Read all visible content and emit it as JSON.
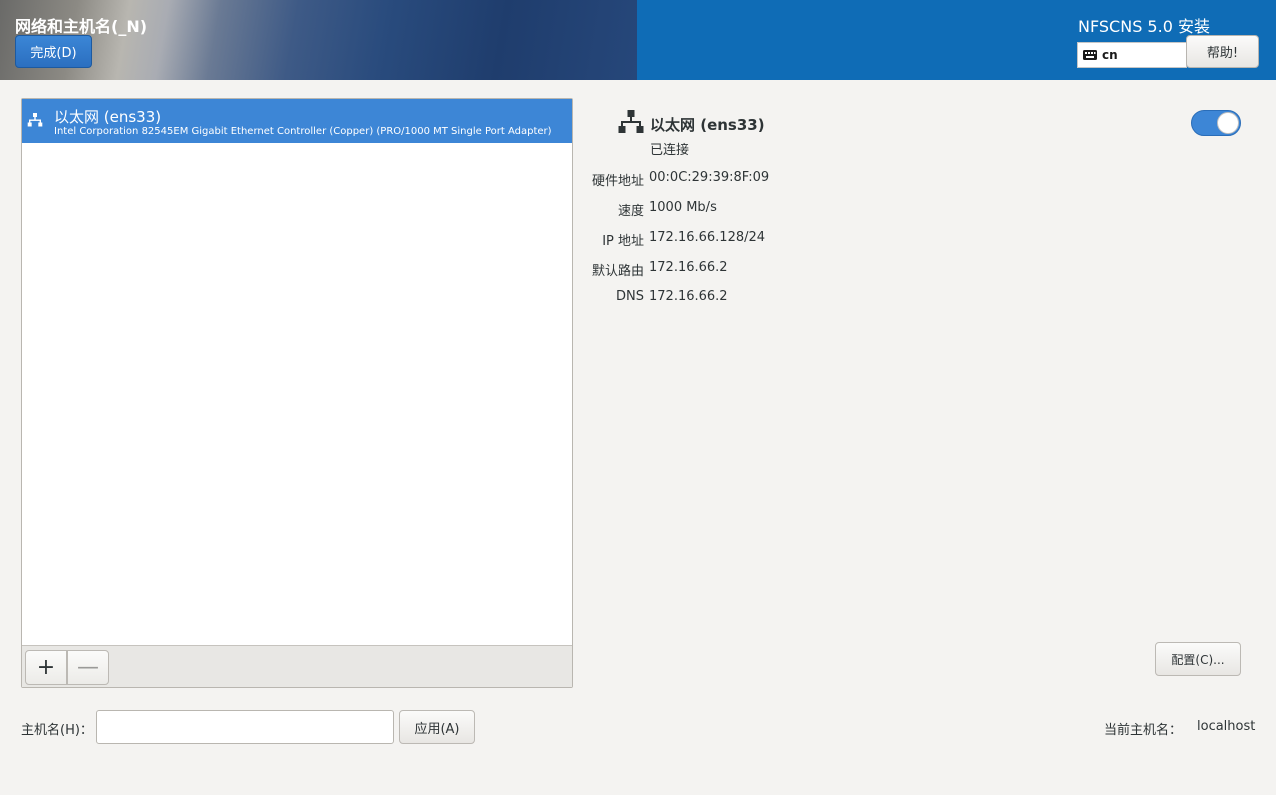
{
  "header": {
    "spoke_title": "网络和主机名(_N)",
    "done_label": "完成(D)",
    "product_title": "NFSCNS 5.0 安装",
    "keyboard_layout": "cn",
    "help_label": "帮助!"
  },
  "devices": [
    {
      "name": "以太网 (ens33)",
      "description": "Intel Corporation 82545EM Gigabit Ethernet Controller (Copper) (PRO/1000 MT Single Port Adapter)",
      "selected": true
    }
  ],
  "list_toolbar": {
    "add_label": "+",
    "remove_label": "—"
  },
  "detail": {
    "name": "以太网 (ens33)",
    "status": "已连接",
    "enabled": true,
    "properties": [
      {
        "label": "硬件地址",
        "value": "00:0C:29:39:8F:09"
      },
      {
        "label": "速度",
        "value": "1000 Mb/s"
      },
      {
        "label": "IP 地址",
        "value": "172.16.66.128/24"
      },
      {
        "label": "默认路由",
        "value": "172.16.66.2"
      },
      {
        "label": "DNS",
        "value": "172.16.66.2"
      }
    ],
    "configure_label": "配置(C)..."
  },
  "hostname": {
    "label": "主机名(H)：",
    "value": "",
    "placeholder": "",
    "apply_label": "应用(A)",
    "current_label": "当前主机名：",
    "current_value": "localhost"
  },
  "colors": {
    "accent": "#3d86d6",
    "header_blue": "#0f6cb6",
    "background": "#f4f3f1"
  },
  "icons": {
    "network": "network-wired-icon",
    "keyboard": "keyboard-icon"
  }
}
